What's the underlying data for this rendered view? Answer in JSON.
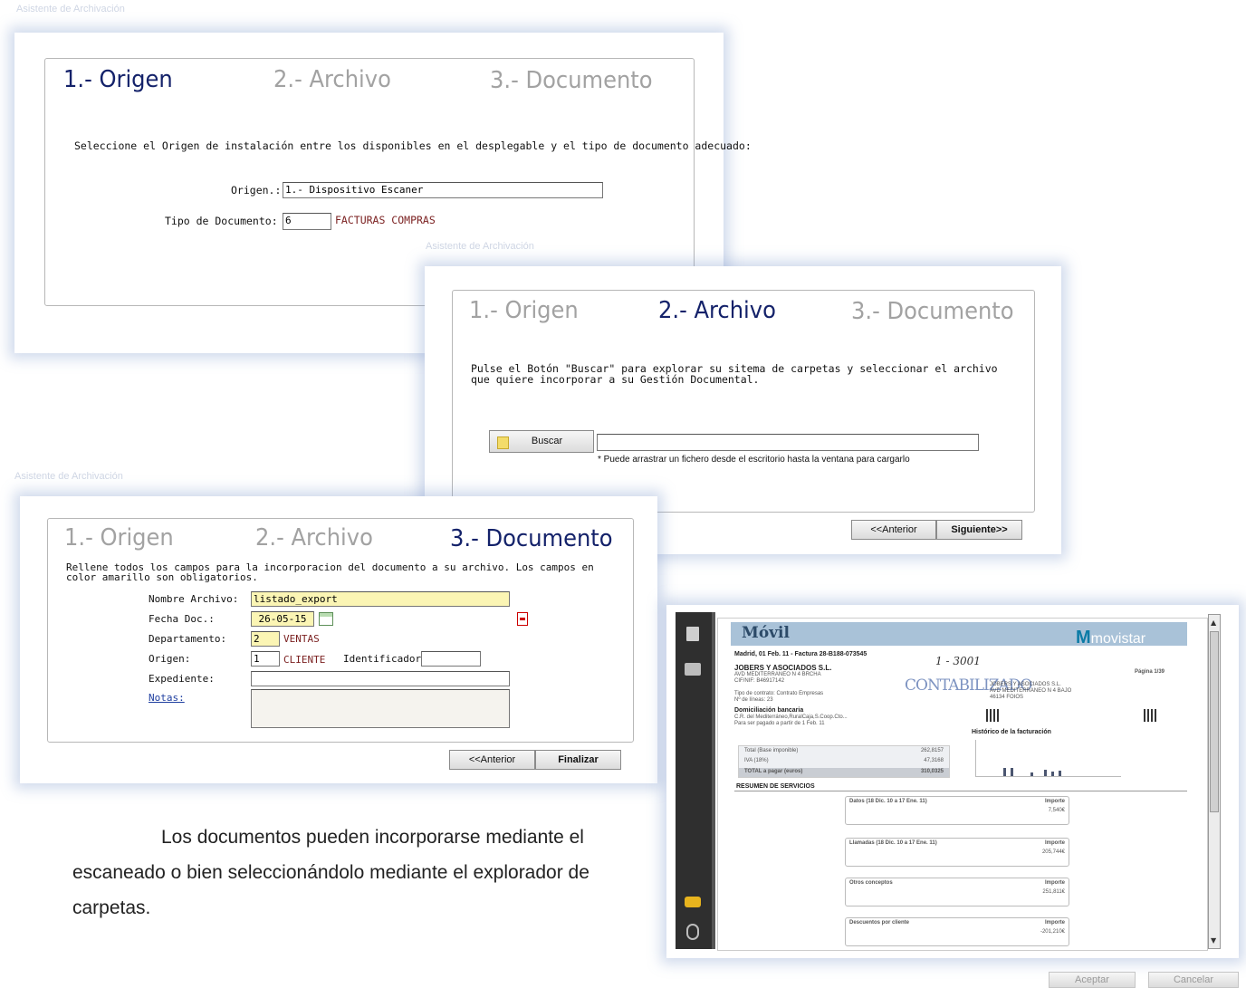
{
  "window_titles": {
    "panel1": "Asistente de Archivación",
    "panel2": "Asistente de Archivación",
    "panel3": "Asistente de Archivación"
  },
  "wizard_steps": [
    "1.- Origen",
    "2.- Archivo",
    "3.- Documento"
  ],
  "step1": {
    "instruction": "Seleccione el Origen de instalación entre los disponibles en el desplegable y el tipo de documento adecuado:",
    "origen_label": "Origen.:",
    "origen_value": "1.- Dispositivo Escaner",
    "tipo_label": "Tipo de Documento:",
    "tipo_value": "6",
    "tipo_desc": "FACTURAS COMPRAS"
  },
  "step2": {
    "instruction": "Pulse el Botón \"Buscar\" para explorar su sitema de carpetas y seleccionar el archivo que quiere incorporar a su Gestión Documental.",
    "buscar_label": "Buscar",
    "file_value": "",
    "drag_hint": "* Puede arrastrar un fichero desde el escritorio hasta la ventana para cargarlo",
    "prev_label": "<<Anterior",
    "next_label": "Siguiente>>"
  },
  "step3": {
    "instruction": "Rellene todos los campos para la incorporacion del documento a su archivo. Los campos en color amarillo son obligatorios.",
    "fields": {
      "nombre_label": "Nombre Archivo:",
      "nombre_value": "listado_export",
      "fecha_label": "Fecha Doc.:",
      "fecha_value": "26-05-15",
      "depto_label": "Departamento:",
      "depto_value": "2",
      "depto_desc": "VENTAS",
      "origen_label": "Origen:",
      "origen_value": "1",
      "origen_desc": "CLIENTE",
      "ident_label": "Identificador:",
      "ident_value": "",
      "expediente_label": "Expediente:",
      "expediente_value": "",
      "notas_label": "Notas:",
      "notas_value": ""
    },
    "prev_label": "<<Anterior",
    "finish_label": "Finalizar"
  },
  "caption": "Los documentos pueden incorporarse mediante el escaneado o bien seleccionándolo mediante el explorador de carpetas.",
  "viewer": {
    "title": "Móvil",
    "brand": "movistar",
    "header_line": "Madrid, 01 Feb. 11 - Factura 28-B188-073545",
    "company": "JOBERS Y ASOCIADOS S.L.",
    "address1": "AVD MEDITERRANEO N 4 BRCHA",
    "cif": "CIF/NIF: B46917142",
    "page_label": "Página 1/39",
    "stamp": "CONTABILIZADO",
    "handwriting": "1 - 3001",
    "recipient_name": "JOBERS Y ASOCIADOS S.L.",
    "recipient_addr": "AVD MEDITERRANEO N 4 BAJO",
    "recipient_city": "46134 FOIOS",
    "contract": "Tipo de contrato: Contrato Empresas",
    "lines": "Nº de líneas: 23",
    "bank_title": "Domiciliación bancaria",
    "bank_line1": "C.R. del Mediterráneo,RuralCaja,S.Coop.Cto...",
    "bank_line2": "Para ser pagado a partir de 1 Feb. 11",
    "history_title": "Histórico de la facturación",
    "totals": [
      {
        "label": "Total (Base imponible)",
        "value": "262,8157"
      },
      {
        "label": "IVA (18%)",
        "value": "47,3168"
      },
      {
        "label": "TOTAL a pagar (euros)",
        "value": "310,0325"
      }
    ],
    "summary_title": "RESUMEN DE SERVICIOS",
    "sections": [
      {
        "title": "Datos (18 Dic. 10 a 17 Ene. 11)",
        "col": "Importe",
        "value": "7,540€"
      },
      {
        "title": "Llamadas (18 Dic. 10 a 17 Ene. 11)",
        "col": "Importe",
        "value": "205,744€"
      },
      {
        "title": "Otros conceptos",
        "col": "Importe",
        "value": "251,811€"
      },
      {
        "title": "Descuentos por cliente",
        "col": "Importe",
        "value": "-201,210€"
      }
    ],
    "accept_label": "Aceptar",
    "cancel_label": "Cancelar"
  }
}
